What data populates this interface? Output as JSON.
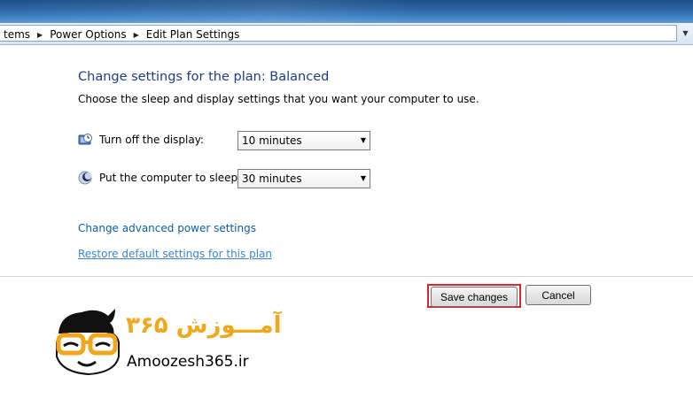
{
  "breadcrumb": {
    "items": [
      "tems",
      "Power Options",
      "Edit Plan Settings"
    ]
  },
  "page": {
    "heading": "Change settings for the plan: Balanced",
    "subtext": "Choose the sleep and display settings that you want your computer to use."
  },
  "settings": {
    "display": {
      "label": "Turn off the display:",
      "value": "10 minutes",
      "icon": "monitor-clock-icon"
    },
    "sleep": {
      "label": "Put the computer to sleep:",
      "value": "30 minutes",
      "icon": "moon-sleep-icon"
    }
  },
  "links": {
    "advanced": "Change advanced power settings",
    "restore": "Restore default settings for this plan"
  },
  "buttons": {
    "save": "Save changes",
    "cancel": "Cancel"
  },
  "watermark": {
    "text_fa": "آمـــوزش ۳۶۵",
    "text_en": "Amoozesh365.ir"
  },
  "colors": {
    "heading": "#1e3b8c",
    "link": "#0b5ea8",
    "highlight": "#d9262c",
    "logo_orange": "#f2a71b"
  }
}
